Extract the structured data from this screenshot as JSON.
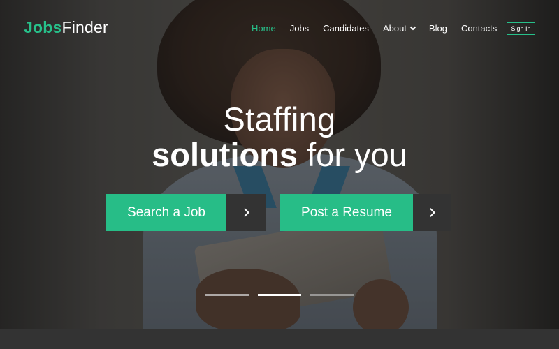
{
  "brand": {
    "name_bold": "Jobs",
    "name_light": "Finder",
    "accent_color": "#27c08a"
  },
  "nav": {
    "items": [
      {
        "label": "Home",
        "active": true
      },
      {
        "label": "Jobs",
        "active": false
      },
      {
        "label": "Candidates",
        "active": false
      },
      {
        "label": "About",
        "active": false,
        "has_dropdown": true,
        "icon": "chevron-down-icon"
      },
      {
        "label": "Blog",
        "active": false
      },
      {
        "label": "Contacts",
        "active": false
      }
    ],
    "sign_in": "Sign In"
  },
  "hero": {
    "line1": "Staffing",
    "line2_bold": "solutions",
    "line2_light": " for you",
    "cta": [
      {
        "label": "Search a Job",
        "icon": "chevron-right-icon"
      },
      {
        "label": "Post a Resume",
        "icon": "chevron-right-icon"
      }
    ],
    "slider": {
      "slides": 3,
      "active_index": 1
    }
  },
  "colors": {
    "button_green": "#27bd87",
    "button_dark": "#333333"
  }
}
